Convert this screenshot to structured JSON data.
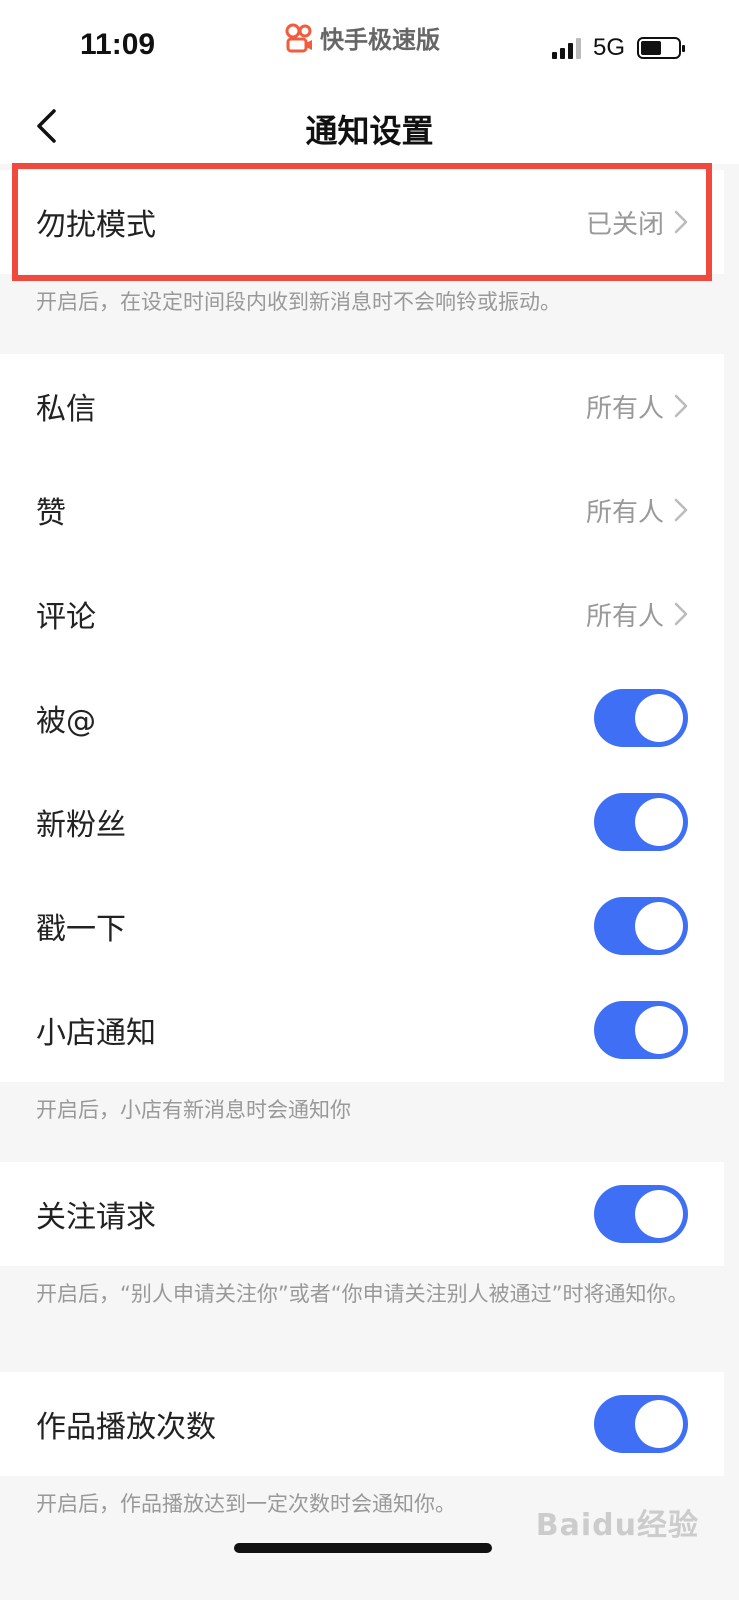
{
  "status_bar": {
    "time": "11:09",
    "app_name": "快手极速版",
    "network": "5G",
    "battery_level": 0.55
  },
  "nav": {
    "title": "通知设置",
    "back_icon": "chevron-left-icon"
  },
  "dnd": {
    "label": "勿扰模式",
    "value": "已关闭",
    "note": "开启后，在设定时间段内收到新消息时不会响铃或振动。"
  },
  "rows": {
    "private_message": {
      "label": "私信",
      "value": "所有人"
    },
    "likes": {
      "label": "赞",
      "value": "所有人"
    },
    "comments": {
      "label": "评论",
      "value": "所有人"
    },
    "mentions": {
      "label": "被@",
      "enabled": true
    },
    "new_fans": {
      "label": "新粉丝",
      "enabled": true
    },
    "poke": {
      "label": "戳一下",
      "enabled": true
    },
    "shop": {
      "label": "小店通知",
      "enabled": true,
      "note": "开启后，小店有新消息时会通知你"
    },
    "follow_request": {
      "label": "关注请求",
      "enabled": true,
      "note": "开启后，“别人申请关注你”或者“你申请关注别人被通过”时将通知你。"
    },
    "play_count": {
      "label": "作品播放次数",
      "enabled": true,
      "note": "开启后，作品播放达到一定次数时会通知你。"
    }
  },
  "colors": {
    "toggle_on": "#3e6ff5",
    "highlight": "#f04a3e"
  },
  "watermark": "Baidu经验"
}
